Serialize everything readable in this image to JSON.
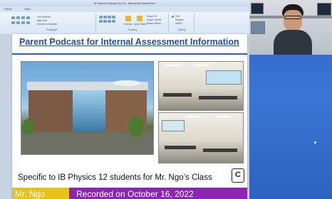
{
  "window": {
    "title": "B Parent Podcast Oct 16 - Microsoft PowerPoint"
  },
  "menu": {
    "tabs": [
      "Home",
      "View"
    ]
  },
  "ribbon": {
    "groups": [
      {
        "label": "Paragraph"
      },
      {
        "label": "Drawing"
      },
      {
        "label": "Editing"
      }
    ],
    "items": [
      "Text Direction",
      "Align Text",
      "Convert to SmartArt",
      "Arrange",
      "Quick Styles",
      "Shape Fill",
      "Shape Outline",
      "Shape Effects",
      "Find",
      "Replace",
      "Select"
    ]
  },
  "slide": {
    "title": "Parent Podcast for Internal Assessment Information",
    "subtitle": "Specific to IB Physics 12 students for Mr. Ngo’s Class",
    "logo_letter": "C",
    "footer_left": "Mr. Ngo",
    "footer_right": "Recorded on October 16, 2022"
  },
  "colors": {
    "title": "#1f4f9e",
    "footer_left_bg": "#e6c21a",
    "footer_right_bg": "#8c25b3",
    "desktop": "#3a6fc7"
  }
}
